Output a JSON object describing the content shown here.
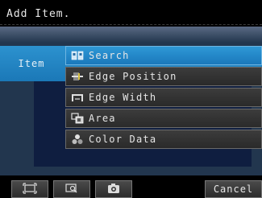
{
  "title": "Add Item.",
  "item_label": "Item",
  "menu": {
    "items": [
      {
        "label": "Search",
        "icon": "search-grid-icon",
        "selected": true
      },
      {
        "label": "Edge Position",
        "icon": "edge-position-icon",
        "selected": false
      },
      {
        "label": "Edge Width",
        "icon": "edge-width-icon",
        "selected": false
      },
      {
        "label": "Area",
        "icon": "area-icon",
        "selected": false
      },
      {
        "label": "Color Data",
        "icon": "color-data-icon",
        "selected": false
      }
    ]
  },
  "toolbar": {
    "buttons": [
      {
        "icon": "frame-icon"
      },
      {
        "icon": "zoom-icon"
      },
      {
        "icon": "camera-icon"
      }
    ],
    "cancel_label": "Cancel"
  },
  "colors": {
    "accent": "#1f86c8",
    "background": "#0a1a3a",
    "text": "#e6e6e6"
  }
}
